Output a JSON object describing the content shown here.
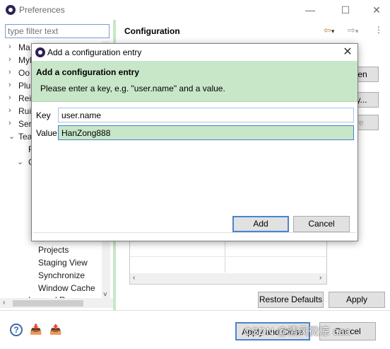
{
  "window": {
    "title": "Preferences",
    "minimize_icon": "minimize-icon",
    "maximize_icon": "maximize-icon",
    "close_icon": "close-icon"
  },
  "filter": {
    "placeholder": "type filter text"
  },
  "tree": {
    "items": [
      {
        "label": "Ma",
        "expander": "›"
      },
      {
        "label": "Myl",
        "expander": "›"
      },
      {
        "label": "Oo",
        "expander": "›"
      },
      {
        "label": "Plu",
        "expander": "›"
      },
      {
        "label": "Rei",
        "expander": "›"
      },
      {
        "label": "Rui",
        "expander": "›"
      },
      {
        "label": "Ser",
        "expander": "›"
      },
      {
        "label": "Tea",
        "expander": "⌄"
      },
      {
        "label": "F",
        "expander": ""
      },
      {
        "label": "G",
        "expander": "⌄"
      },
      {
        "label": "Projects",
        "expander": ""
      },
      {
        "label": "Staging View",
        "expander": ""
      },
      {
        "label": "Synchronize",
        "expander": ""
      },
      {
        "label": "Window Cache",
        "expander": ""
      },
      {
        "label": "Ignored Resources",
        "expander": ""
      }
    ]
  },
  "right_pane": {
    "title": "Configuration",
    "open_button": "Open",
    "entry_button": "ntry...",
    "remove_button": "ove",
    "restore_defaults": "Restore Defaults",
    "apply": "Apply"
  },
  "bottom": {
    "apply_and_close": "Apply and Close",
    "cancel": "Cancel"
  },
  "dialog": {
    "title": "Add a configuration entry",
    "banner_title": "Add a configuration entry",
    "banner_desc": "Please enter a key, e.g. \"user.name\" and a value.",
    "key_label": "Key",
    "key_value": "user.name",
    "value_label": "Value",
    "value_value": "HanZong888",
    "add_button": "Add",
    "cancel_button": "Cancel"
  },
  "watermark": "CSDN @清风微凉 aaa",
  "colors": {
    "accent_green": "#c8e6c8",
    "focus_blue": "#3d84cf"
  }
}
